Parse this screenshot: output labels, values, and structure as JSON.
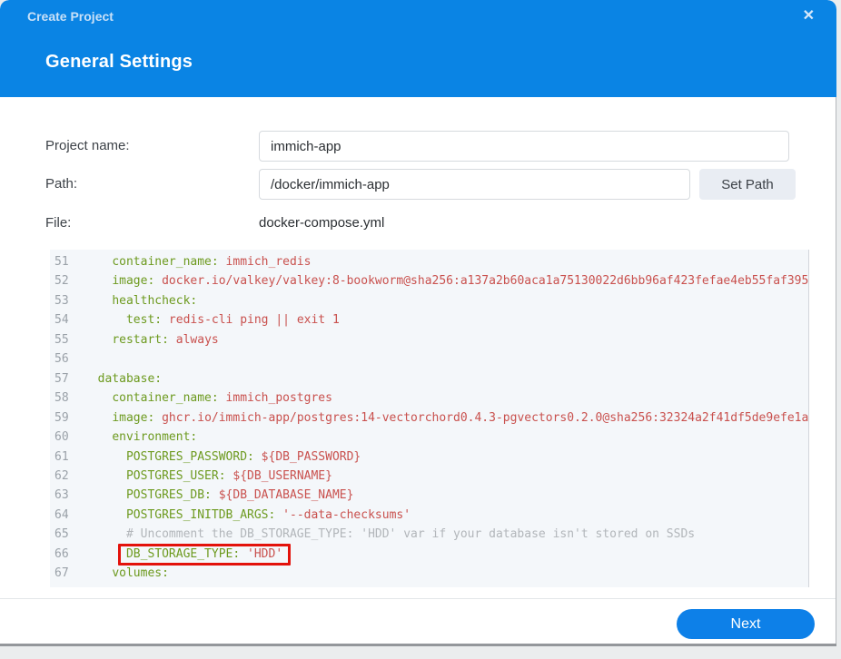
{
  "dialog": {
    "title": "Create Project",
    "close_icon": "✕",
    "section_title": "General Settings"
  },
  "form": {
    "project_name": {
      "label": "Project name:",
      "value": "immich-app"
    },
    "path": {
      "label": "Path:",
      "value": "/docker/immich-app",
      "button_label": "Set Path"
    },
    "file": {
      "label": "File:",
      "value": "docker-compose.yml"
    }
  },
  "editor": {
    "lines": [
      {
        "num": "51",
        "tokens": [
          [
            "    ",
            "plain"
          ],
          [
            "container_name:",
            "key"
          ],
          [
            " immich_redis",
            "val"
          ]
        ]
      },
      {
        "num": "52",
        "tokens": [
          [
            "    ",
            "plain"
          ],
          [
            "image:",
            "key"
          ],
          [
            " docker.io/valkey/valkey:8-bookworm@sha256:a137a2b60aca1a75130022d6bb96af423fefae4eb55faf395",
            "val"
          ]
        ]
      },
      {
        "num": "53",
        "tokens": [
          [
            "    ",
            "plain"
          ],
          [
            "healthcheck:",
            "key"
          ]
        ]
      },
      {
        "num": "54",
        "tokens": [
          [
            "      ",
            "plain"
          ],
          [
            "test:",
            "key"
          ],
          [
            " redis-cli ping || exit 1",
            "val"
          ]
        ]
      },
      {
        "num": "55",
        "tokens": [
          [
            "    ",
            "plain"
          ],
          [
            "restart:",
            "key"
          ],
          [
            " always",
            "val"
          ]
        ]
      },
      {
        "num": "56",
        "tokens": [
          [
            "",
            "plain"
          ]
        ]
      },
      {
        "num": "57",
        "tokens": [
          [
            "  ",
            "plain"
          ],
          [
            "database:",
            "key"
          ]
        ]
      },
      {
        "num": "58",
        "tokens": [
          [
            "    ",
            "plain"
          ],
          [
            "container_name:",
            "key"
          ],
          [
            " immich_postgres",
            "val"
          ]
        ]
      },
      {
        "num": "59",
        "tokens": [
          [
            "    ",
            "plain"
          ],
          [
            "image:",
            "key"
          ],
          [
            " ghcr.io/immich-app/postgres:14-vectorchord0.4.3-pgvectors0.2.0@sha256:32324a2f41df5de9efe1a",
            "val"
          ]
        ]
      },
      {
        "num": "60",
        "tokens": [
          [
            "    ",
            "plain"
          ],
          [
            "environment:",
            "key"
          ]
        ]
      },
      {
        "num": "61",
        "tokens": [
          [
            "      ",
            "plain"
          ],
          [
            "POSTGRES_PASSWORD:",
            "key"
          ],
          [
            " ${DB_PASSWORD}",
            "val"
          ]
        ]
      },
      {
        "num": "62",
        "tokens": [
          [
            "      ",
            "plain"
          ],
          [
            "POSTGRES_USER:",
            "key"
          ],
          [
            " ${DB_USERNAME}",
            "val"
          ]
        ]
      },
      {
        "num": "63",
        "tokens": [
          [
            "      ",
            "plain"
          ],
          [
            "POSTGRES_DB:",
            "key"
          ],
          [
            " ${DB_DATABASE_NAME}",
            "val"
          ]
        ]
      },
      {
        "num": "64",
        "tokens": [
          [
            "      ",
            "plain"
          ],
          [
            "POSTGRES_INITDB_ARGS:",
            "key"
          ],
          [
            " '--data-checksums'",
            "val"
          ]
        ]
      },
      {
        "num": "65",
        "tokens": [
          [
            "      ",
            "plain"
          ],
          [
            "# Uncomment the DB_STORAGE_TYPE: 'HDD' var if your database isn't stored on SSDs",
            "com"
          ]
        ]
      },
      {
        "num": "66",
        "hl": true,
        "tokens": [
          [
            "      ",
            "plain"
          ],
          [
            "DB_STORAGE_TYPE:",
            "key"
          ],
          [
            " 'HDD'",
            "val"
          ]
        ]
      },
      {
        "num": "67",
        "tokens": [
          [
            "    ",
            "plain"
          ],
          [
            "volumes:",
            "key"
          ]
        ]
      }
    ]
  },
  "footer": {
    "next_label": "Next"
  },
  "colors": {
    "header_blue": "#0a84e4",
    "next_button_blue": "#0d80e8",
    "yaml_key_green": "#6d9a1f",
    "yaml_value_red": "#c9514e",
    "comment_gray": "#b2b6ba",
    "highlight_box_red": "#e3120b",
    "editor_background": "#f4f7fa"
  }
}
